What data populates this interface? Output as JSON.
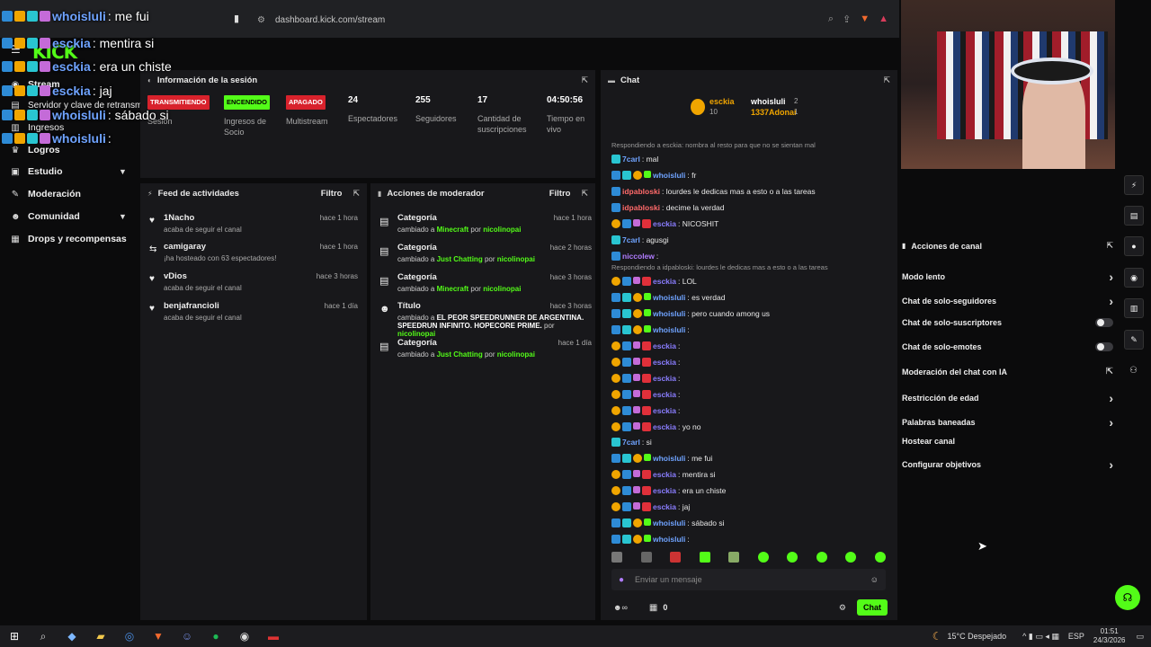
{
  "browser": {
    "url": "dashboard.kick.com/stream"
  },
  "brand": {
    "logo": "KICK"
  },
  "sidebar": {
    "items": [
      {
        "label": "Stream",
        "icon": "broadcast-icon"
      },
      {
        "label": "Servidor y clave de retransm",
        "icon": "server-icon"
      },
      {
        "label": "Ingresos",
        "icon": "revenue-icon"
      },
      {
        "label": "Logros",
        "icon": "trophy-icon"
      },
      {
        "label": "Estudio",
        "icon": "studio-icon"
      },
      {
        "label": "Moderación",
        "icon": "wrench-icon"
      },
      {
        "label": "Comunidad",
        "icon": "users-icon"
      },
      {
        "label": "Drops y recompensas",
        "icon": "gift-icon"
      }
    ]
  },
  "session": {
    "title": "Información de la sesión",
    "stats": [
      {
        "badge": "TRANSMITIENDO",
        "label": "Sesión"
      },
      {
        "badge": "ENCENDIDO",
        "label": "Ingresos de Socio"
      },
      {
        "badge": "APAGADO",
        "label": "Multistream"
      },
      {
        "value": "24",
        "label": "Espectadores"
      },
      {
        "value": "255",
        "label": "Seguidores"
      },
      {
        "value": "17",
        "label": "Cantidad de suscripciones"
      },
      {
        "value": "04:50:56",
        "label": "Tiempo en vivo"
      }
    ]
  },
  "feed": {
    "title": "Feed de actividades",
    "filter": "Filtro",
    "items": [
      {
        "name": "1Nacho",
        "sub": "acaba de seguir el canal",
        "time": "hace 1 hora"
      },
      {
        "name": "camigaray",
        "sub": "¡ha hosteado con 63 espectadores!",
        "time": "hace 1 hora"
      },
      {
        "name": "vDios",
        "sub": "acaba de seguir el canal",
        "time": "hace 3 horas"
      },
      {
        "name": "benjafrancioli",
        "sub": "acaba de seguir el canal",
        "time": "hace 1 día"
      }
    ]
  },
  "modActions": {
    "title": "Acciones de moderador",
    "filter": "Filtro",
    "items": [
      {
        "name": "Categoría",
        "pre": "cambiado a",
        "target": "Minecraft",
        "by": "por",
        "mod": "nicolinopai",
        "time": "hace 1 hora"
      },
      {
        "name": "Categoría",
        "pre": "cambiado a",
        "target": "Just Chatting",
        "by": "por",
        "mod": "nicolinopai",
        "time": "hace 2 horas"
      },
      {
        "name": "Categoría",
        "pre": "cambiado a",
        "target": "Minecraft",
        "by": "por",
        "mod": "nicolinopai",
        "time": "hace 3 horas"
      },
      {
        "name": "Título",
        "pre": "cambiado a",
        "target": "EL PEOR SPEEDRUNNER DE ARGENTINA. SPEEDRUN INFINITO. HOPECORE PRIME.",
        "by": "por",
        "mod": "nicolinopai",
        "time": "hace 3 horas"
      },
      {
        "name": "Categoría",
        "pre": "cambiado a",
        "target": "Just Chatting",
        "by": "por",
        "mod": "nicolinopai",
        "time": "hace 1 día"
      }
    ]
  },
  "chat": {
    "title": "Chat",
    "top": [
      {
        "name": "esckia",
        "count": "10"
      },
      {
        "name": "whoisluli",
        "count": "2"
      },
      {
        "name": "1337Adonai",
        "count": "1"
      }
    ],
    "reply1": "Respondiendo a esckia: nombra al resto para que no se sientan mal",
    "reply2": "Respondiendo a idpabloski: lourdes le dedicas mas a esto o a las tareas",
    "messages": [
      {
        "user": "7carl",
        "text": ": mal"
      },
      {
        "user": "whoisluli",
        "text": ": fr"
      },
      {
        "user": "idpabloski",
        "text": ": lourdes le dedicas mas a esto o a las tareas"
      },
      {
        "user": "idpabloski",
        "text": ": decime la verdad"
      },
      {
        "user": "esckia",
        "text": ": NICOSHIT"
      },
      {
        "user": "7carl",
        "text": ": agusgi"
      },
      {
        "user": "niccolew",
        "text": ":"
      },
      {
        "user": "esckia",
        "text": ": LOL"
      },
      {
        "user": "whoisluli",
        "text": ": es verdad"
      },
      {
        "user": "whoisluli",
        "text": ": pero cuando among us"
      },
      {
        "user": "whoisluli",
        "text": ":"
      },
      {
        "user": "esckia",
        "text": ":"
      },
      {
        "user": "esckia",
        "text": ":"
      },
      {
        "user": "esckia",
        "text": ":"
      },
      {
        "user": "esckia",
        "text": ":"
      },
      {
        "user": "esckia",
        "text": ":"
      },
      {
        "user": "esckia",
        "text": ": yo no"
      },
      {
        "user": "7carl",
        "text": ": si"
      },
      {
        "user": "whoisluli",
        "text": ": me fui"
      },
      {
        "user": "esckia",
        "text": ": mentira si"
      },
      {
        "user": "esckia",
        "text": ": era un chiste"
      },
      {
        "user": "esckia",
        "text": ": jaj"
      },
      {
        "user": "whoisluli",
        "text": ": sábado si"
      },
      {
        "user": "whoisluli",
        "text": ":"
      }
    ],
    "placeholder": "Enviar un mensaje",
    "viewers": "0",
    "send": "Chat"
  },
  "channelActions": {
    "title": "Acciones de canal",
    "items": [
      {
        "label": "Modo lento",
        "kind": "arrow"
      },
      {
        "label": "Chat de solo-seguidores",
        "kind": "arrow"
      },
      {
        "label": "Chat de solo-suscriptores",
        "kind": "toggle"
      },
      {
        "label": "Chat de solo-emotes",
        "kind": "toggle"
      },
      {
        "label": "Moderación del chat con IA",
        "kind": "external"
      },
      {
        "label": "Restricción de edad",
        "kind": "arrow"
      },
      {
        "label": "Palabras baneadas",
        "kind": "arrow"
      },
      {
        "label": "Hostear canal",
        "kind": "none"
      },
      {
        "label": "Configurar objetivos",
        "kind": "arrow"
      }
    ]
  },
  "overlay": [
    {
      "user": "whoisluli",
      "text": ": me fui"
    },
    {
      "user": "esckia",
      "text": ": mentira si"
    },
    {
      "user": "esckia",
      "text": ": era un chiste"
    },
    {
      "user": "esckia",
      "text": ": jaj"
    },
    {
      "user": "whoisluli",
      "text": ": sábado si"
    },
    {
      "user": "whoisluli",
      "text": ":"
    }
  ],
  "taskbar": {
    "weather": "15°C Despejado",
    "lang": "ESP",
    "time": "01:51",
    "date": "24/3/2026"
  }
}
